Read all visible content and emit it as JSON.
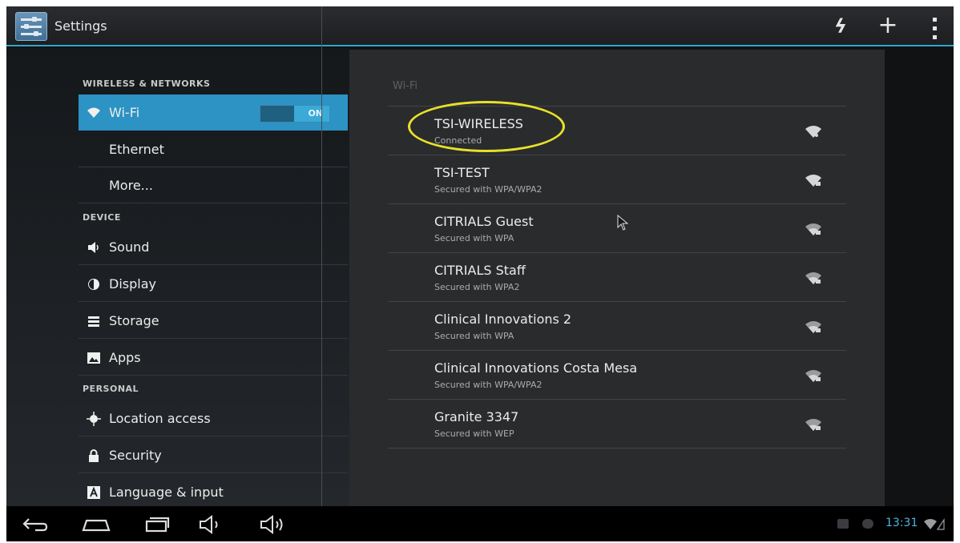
{
  "window": {
    "title": "Settings"
  },
  "sidebar": {
    "sections": [
      "WIRELESS & NETWORKS",
      "DEVICE",
      "PERSONAL"
    ],
    "items": [
      {
        "label": "Wi-Fi",
        "icon": "wifi-icon"
      },
      {
        "label": "Ethernet"
      },
      {
        "label": "More..."
      },
      {
        "label": "Sound",
        "icon": "speaker-icon"
      },
      {
        "label": "Display",
        "icon": "brightness-icon"
      },
      {
        "label": "Storage",
        "icon": "storage-icon"
      },
      {
        "label": "Apps",
        "icon": "apps-icon"
      },
      {
        "label": "Location access",
        "icon": "location-icon"
      },
      {
        "label": "Security",
        "icon": "lock-icon"
      },
      {
        "label": "Language & input",
        "icon": "keyboard-letter-icon"
      }
    ],
    "wifi_toggle": "ON"
  },
  "wifi_panel": {
    "title": "Wi-Fi",
    "networks": [
      {
        "name": "TSI-WIRELESS",
        "status": "Connected"
      },
      {
        "name": "TSI-TEST",
        "status": "Secured with WPA/WPA2"
      },
      {
        "name": "CITRIALS Guest",
        "status": "Secured with WPA"
      },
      {
        "name": "CITRIALS Staff",
        "status": "Secured with WPA2"
      },
      {
        "name": "Clinical Innovations 2",
        "status": "Secured with WPA"
      },
      {
        "name": "Clinical Innovations Costa Mesa",
        "status": "Secured with WPA/WPA2"
      },
      {
        "name": "Granite 3347",
        "status": "Secured with WEP"
      }
    ]
  },
  "status_bar": {
    "time": "13:31"
  },
  "colors": {
    "accent": "#2c93c4",
    "highlight": "#e8e02a"
  }
}
